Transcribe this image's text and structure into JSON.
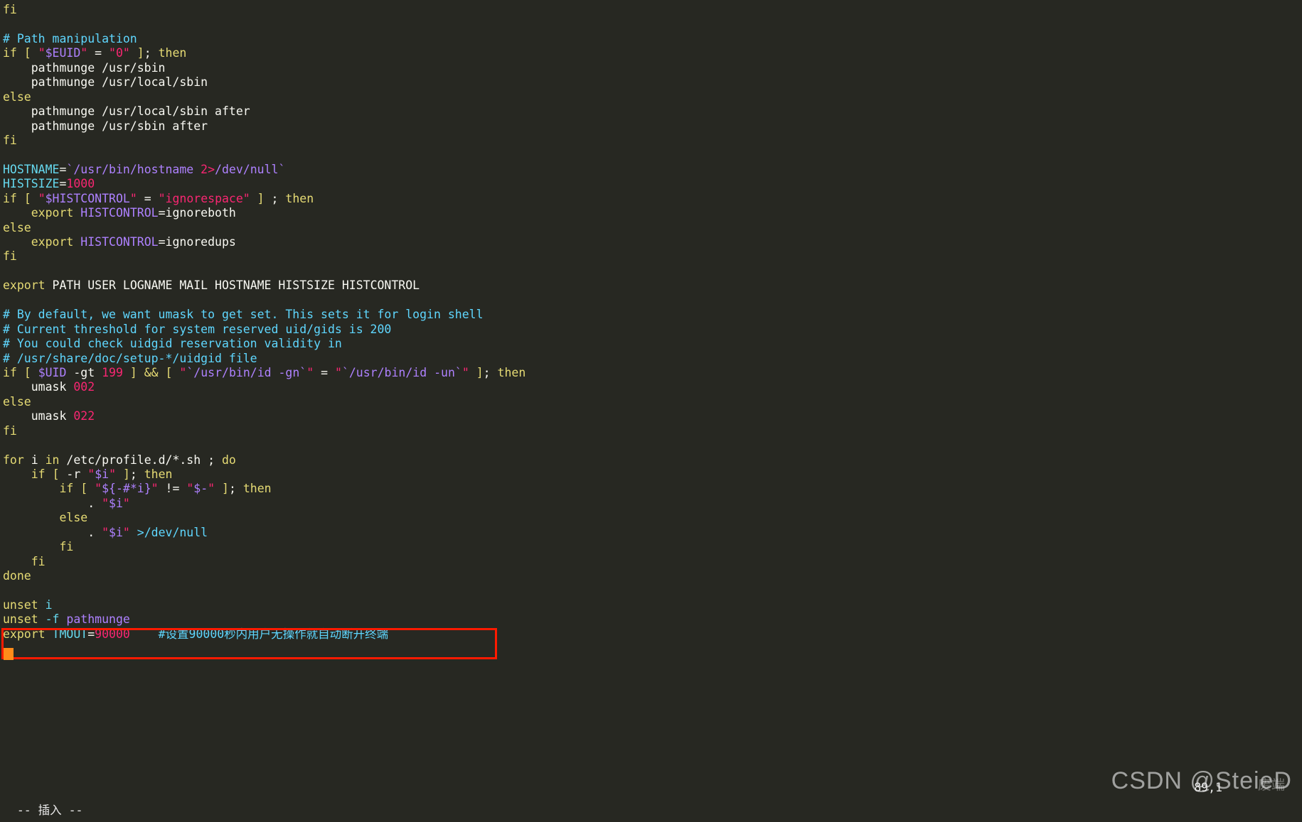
{
  "app": {
    "name": "vim",
    "theme_background": "#272822",
    "foreground": "#f8f8f2",
    "accent_keyword": "#e6db74",
    "accent_comment": "#5fd7ff",
    "accent_variable": "#ae81ff",
    "accent_number": "#f92672",
    "highlight_box_color": "#ff1a00",
    "cursor_color": "#ff8c1a"
  },
  "statusline": {
    "mode": "-- 插入 --",
    "ruler": "89,1"
  },
  "watermark": {
    "text": "CSDN @SteieD",
    "secondary": "废端"
  },
  "highlight": {
    "boxed_line_text": "export TMOUT=90000    #设置90000秒内用户无操作就自动断开终端",
    "variable": "TMOUT",
    "value": "90000",
    "comment": "#设置90000秒内用户无操作就自动断开终端"
  },
  "buffer": {
    "lines": [
      [
        {
          "t": "fi",
          "c": "kw"
        }
      ],
      [],
      [
        {
          "t": "# Path manipulation",
          "c": "cmt"
        }
      ],
      [
        {
          "t": "if",
          "c": "kw"
        },
        {
          "t": " ",
          "c": "plain"
        },
        {
          "t": "[",
          "c": "kw"
        },
        {
          "t": " ",
          "c": "plain"
        },
        {
          "t": "\"",
          "c": "num"
        },
        {
          "t": "$EUID",
          "c": "var"
        },
        {
          "t": "\"",
          "c": "num"
        },
        {
          "t": " = ",
          "c": "plain"
        },
        {
          "t": "\"",
          "c": "num"
        },
        {
          "t": "0",
          "c": "num"
        },
        {
          "t": "\"",
          "c": "num"
        },
        {
          "t": " ",
          "c": "plain"
        },
        {
          "t": "]",
          "c": "kw"
        },
        {
          "t": "; ",
          "c": "plain"
        },
        {
          "t": "then",
          "c": "kw"
        }
      ],
      [
        {
          "t": "    pathmunge /usr/sbin",
          "c": "plain"
        }
      ],
      [
        {
          "t": "    pathmunge /usr/local/sbin",
          "c": "plain"
        }
      ],
      [
        {
          "t": "else",
          "c": "kw"
        }
      ],
      [
        {
          "t": "    pathmunge /usr/local/sbin after",
          "c": "plain"
        }
      ],
      [
        {
          "t": "    pathmunge /usr/sbin after",
          "c": "plain"
        }
      ],
      [
        {
          "t": "fi",
          "c": "kw"
        }
      ],
      [],
      [
        {
          "t": "HOSTNAME",
          "c": "cyan"
        },
        {
          "t": "=",
          "c": "plain"
        },
        {
          "t": "`/usr/bin/hostname ",
          "c": "var"
        },
        {
          "t": "2>",
          "c": "num"
        },
        {
          "t": "/dev/null`",
          "c": "var"
        }
      ],
      [
        {
          "t": "HISTSIZE",
          "c": "cyan"
        },
        {
          "t": "=",
          "c": "plain"
        },
        {
          "t": "1000",
          "c": "num"
        }
      ],
      [
        {
          "t": "if",
          "c": "kw"
        },
        {
          "t": " ",
          "c": "plain"
        },
        {
          "t": "[",
          "c": "kw"
        },
        {
          "t": " ",
          "c": "plain"
        },
        {
          "t": "\"",
          "c": "num"
        },
        {
          "t": "$HISTCONTROL",
          "c": "var"
        },
        {
          "t": "\"",
          "c": "num"
        },
        {
          "t": " = ",
          "c": "plain"
        },
        {
          "t": "\"ignorespace\"",
          "c": "num"
        },
        {
          "t": " ",
          "c": "plain"
        },
        {
          "t": "]",
          "c": "kw"
        },
        {
          "t": " ; ",
          "c": "plain"
        },
        {
          "t": "then",
          "c": "kw"
        }
      ],
      [
        {
          "t": "    ",
          "c": "plain"
        },
        {
          "t": "export",
          "c": "kw"
        },
        {
          "t": " ",
          "c": "plain"
        },
        {
          "t": "HISTCONTROL",
          "c": "var"
        },
        {
          "t": "=ignoreboth",
          "c": "plain"
        }
      ],
      [
        {
          "t": "else",
          "c": "kw"
        }
      ],
      [
        {
          "t": "    ",
          "c": "plain"
        },
        {
          "t": "export",
          "c": "kw"
        },
        {
          "t": " ",
          "c": "plain"
        },
        {
          "t": "HISTCONTROL",
          "c": "var"
        },
        {
          "t": "=ignoredups",
          "c": "plain"
        }
      ],
      [
        {
          "t": "fi",
          "c": "kw"
        }
      ],
      [],
      [
        {
          "t": "export",
          "c": "kw"
        },
        {
          "t": " PATH USER LOGNAME MAIL HOSTNAME HISTSIZE HISTCONTROL",
          "c": "plain"
        }
      ],
      [],
      [
        {
          "t": "# By default, we want umask to get set. This sets it for login shell",
          "c": "cmt"
        }
      ],
      [
        {
          "t": "# Current threshold for system reserved uid/gids is 200",
          "c": "cmt"
        }
      ],
      [
        {
          "t": "# You could check uidgid reservation validity in",
          "c": "cmt"
        }
      ],
      [
        {
          "t": "# /usr/share/doc/setup-*/uidgid file",
          "c": "cmt"
        }
      ],
      [
        {
          "t": "if",
          "c": "kw"
        },
        {
          "t": " ",
          "c": "plain"
        },
        {
          "t": "[",
          "c": "kw"
        },
        {
          "t": " ",
          "c": "plain"
        },
        {
          "t": "$UID",
          "c": "var"
        },
        {
          "t": " -gt ",
          "c": "plain"
        },
        {
          "t": "199",
          "c": "num"
        },
        {
          "t": " ",
          "c": "plain"
        },
        {
          "t": "]",
          "c": "kw"
        },
        {
          "t": " ",
          "c": "plain"
        },
        {
          "t": "&&",
          "c": "kw"
        },
        {
          "t": " ",
          "c": "plain"
        },
        {
          "t": "[",
          "c": "kw"
        },
        {
          "t": " ",
          "c": "plain"
        },
        {
          "t": "\"",
          "c": "num"
        },
        {
          "t": "`/usr/bin/id -gn`",
          "c": "var"
        },
        {
          "t": "\"",
          "c": "num"
        },
        {
          "t": " = ",
          "c": "plain"
        },
        {
          "t": "\"",
          "c": "num"
        },
        {
          "t": "`/usr/bin/id -un`",
          "c": "var"
        },
        {
          "t": "\"",
          "c": "num"
        },
        {
          "t": " ",
          "c": "plain"
        },
        {
          "t": "]",
          "c": "kw"
        },
        {
          "t": "; ",
          "c": "plain"
        },
        {
          "t": "then",
          "c": "kw"
        }
      ],
      [
        {
          "t": "    umask ",
          "c": "plain"
        },
        {
          "t": "002",
          "c": "num"
        }
      ],
      [
        {
          "t": "else",
          "c": "kw"
        }
      ],
      [
        {
          "t": "    umask ",
          "c": "plain"
        },
        {
          "t": "022",
          "c": "num"
        }
      ],
      [
        {
          "t": "fi",
          "c": "kw"
        }
      ],
      [],
      [
        {
          "t": "for",
          "c": "kw"
        },
        {
          "t": " i ",
          "c": "plain"
        },
        {
          "t": "in",
          "c": "kw"
        },
        {
          "t": " /etc/profile.d/*.sh ; ",
          "c": "plain"
        },
        {
          "t": "do",
          "c": "kw"
        }
      ],
      [
        {
          "t": "    ",
          "c": "plain"
        },
        {
          "t": "if",
          "c": "kw"
        },
        {
          "t": " ",
          "c": "plain"
        },
        {
          "t": "[",
          "c": "kw"
        },
        {
          "t": " -r ",
          "c": "plain"
        },
        {
          "t": "\"",
          "c": "num"
        },
        {
          "t": "$i",
          "c": "var"
        },
        {
          "t": "\"",
          "c": "num"
        },
        {
          "t": " ",
          "c": "plain"
        },
        {
          "t": "]",
          "c": "kw"
        },
        {
          "t": "; ",
          "c": "plain"
        },
        {
          "t": "then",
          "c": "kw"
        }
      ],
      [
        {
          "t": "        ",
          "c": "plain"
        },
        {
          "t": "if",
          "c": "kw"
        },
        {
          "t": " ",
          "c": "plain"
        },
        {
          "t": "[",
          "c": "kw"
        },
        {
          "t": " ",
          "c": "plain"
        },
        {
          "t": "\"",
          "c": "num"
        },
        {
          "t": "${-#*i}",
          "c": "var"
        },
        {
          "t": "\"",
          "c": "num"
        },
        {
          "t": " != ",
          "c": "plain"
        },
        {
          "t": "\"",
          "c": "num"
        },
        {
          "t": "$-",
          "c": "var"
        },
        {
          "t": "\"",
          "c": "num"
        },
        {
          "t": " ",
          "c": "plain"
        },
        {
          "t": "]",
          "c": "kw"
        },
        {
          "t": "; ",
          "c": "plain"
        },
        {
          "t": "then",
          "c": "kw"
        }
      ],
      [
        {
          "t": "            . ",
          "c": "plain"
        },
        {
          "t": "\"",
          "c": "num"
        },
        {
          "t": "$i",
          "c": "var"
        },
        {
          "t": "\"",
          "c": "num"
        }
      ],
      [
        {
          "t": "        ",
          "c": "plain"
        },
        {
          "t": "else",
          "c": "kw"
        }
      ],
      [
        {
          "t": "            . ",
          "c": "plain"
        },
        {
          "t": "\"",
          "c": "num"
        },
        {
          "t": "$i",
          "c": "var"
        },
        {
          "t": "\"",
          "c": "num"
        },
        {
          "t": " ",
          "c": "plain"
        },
        {
          "t": ">",
          "c": "cmt"
        },
        {
          "t": "/dev/null",
          "c": "cmt"
        }
      ],
      [
        {
          "t": "        ",
          "c": "plain"
        },
        {
          "t": "fi",
          "c": "kw"
        }
      ],
      [
        {
          "t": "    ",
          "c": "plain"
        },
        {
          "t": "fi",
          "c": "kw"
        }
      ],
      [
        {
          "t": "done",
          "c": "kw"
        }
      ],
      [],
      [
        {
          "t": "unset",
          "c": "kw"
        },
        {
          "t": " ",
          "c": "plain"
        },
        {
          "t": "i",
          "c": "cyan"
        }
      ],
      [
        {
          "t": "unset",
          "c": "kw"
        },
        {
          "t": " ",
          "c": "plain"
        },
        {
          "t": "-f",
          "c": "cyan"
        },
        {
          "t": " ",
          "c": "plain"
        },
        {
          "t": "pathmunge",
          "c": "var"
        }
      ],
      [
        {
          "t": "export",
          "c": "kw"
        },
        {
          "t": " ",
          "c": "plain"
        },
        {
          "t": "TMOUT",
          "c": "cyan"
        },
        {
          "t": "=",
          "c": "plain"
        },
        {
          "t": "90000",
          "c": "num"
        },
        {
          "t": "    ",
          "c": "plain"
        },
        {
          "t": "#设置90000秒内用户无操作就自动断开终端",
          "c": "cmt"
        }
      ],
      []
    ]
  }
}
